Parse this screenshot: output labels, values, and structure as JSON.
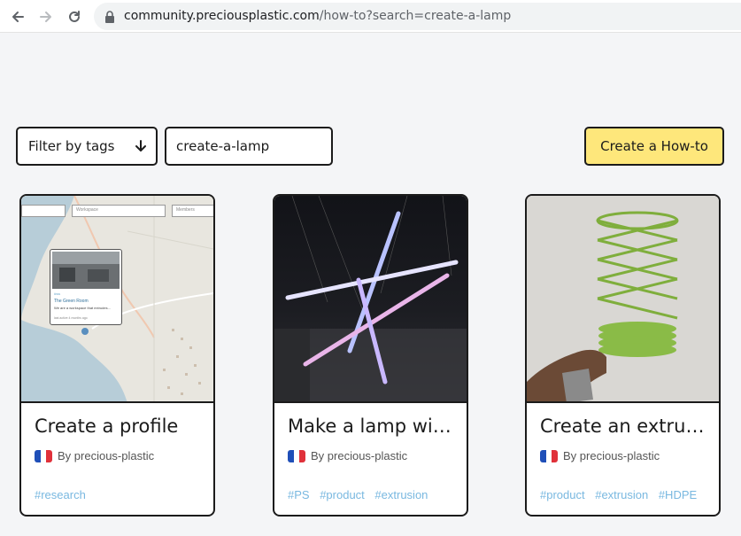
{
  "browser": {
    "url_domain": "community.preciousplastic.com",
    "url_path": "/how-to?search=create-a-lamp"
  },
  "toolbar": {
    "filter_label": "Filter by tags",
    "search_value": "create-a-lamp",
    "create_label": "Create a How-to"
  },
  "cards": [
    {
      "title": "Create a profile",
      "author": "By precious-plastic",
      "tags": [
        "#research"
      ],
      "map": {
        "field_2": "Workspace",
        "field_3": "Members",
        "popup_tag": "#ws",
        "popup_title": "The Green Room",
        "popup_desc": "We are a workspace that extrudes...",
        "popup_time": "last active 4 months ago"
      }
    },
    {
      "title": "Make a lamp with extruded beams",
      "author": "By precious-plastic",
      "tags": [
        "#PS",
        "#product",
        "#extrusion"
      ]
    },
    {
      "title": "Create an extruded lamp",
      "author": "By precious-plastic",
      "tags": [
        "#product",
        "#extrusion",
        "#HDPE"
      ]
    }
  ],
  "colors": {
    "accent_yellow": "#fee77b",
    "tag_blue": "#79b8e0",
    "page_bg": "#f4f5f7",
    "border": "#1b1b1b"
  },
  "icons": {
    "back": "arrow-left-icon",
    "forward": "arrow-right-icon",
    "reload": "reload-icon",
    "lock": "lock-icon",
    "filter": "arrow-down-icon",
    "flag": "flag-france-icon"
  }
}
